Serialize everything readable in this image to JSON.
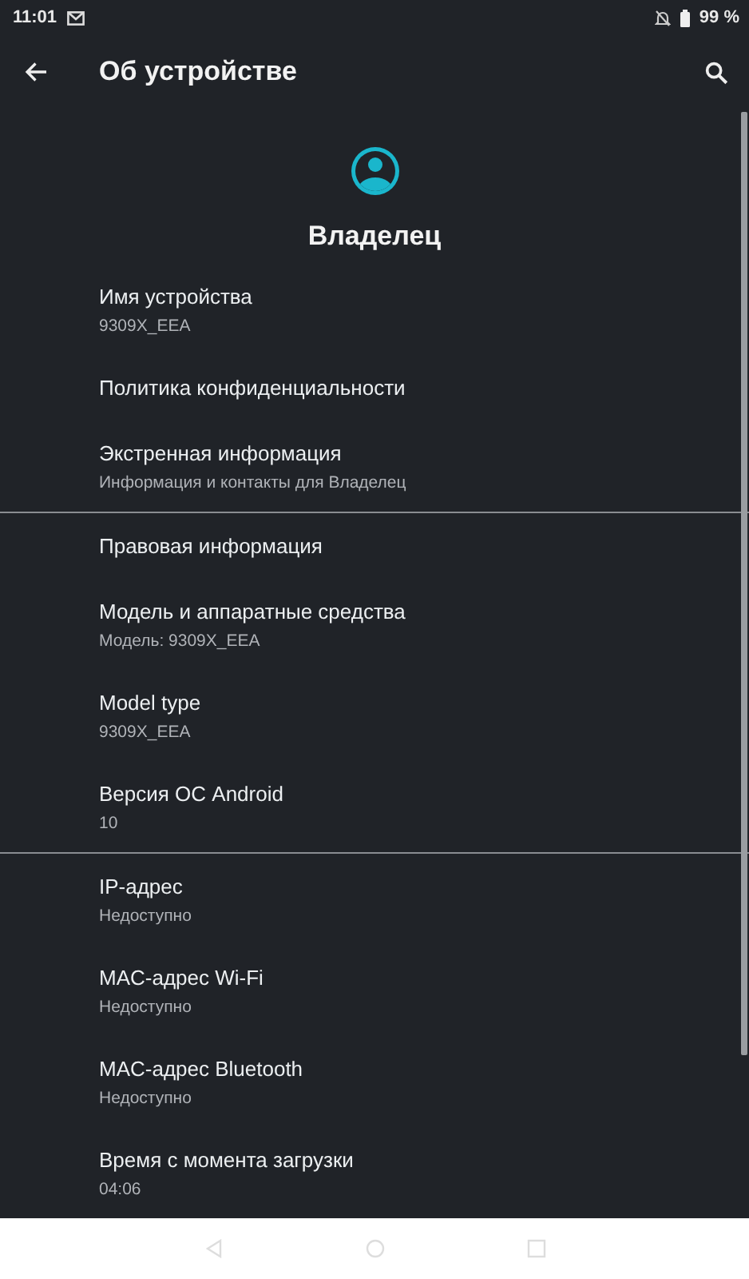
{
  "status_bar": {
    "time": "11:01",
    "battery": "99 %"
  },
  "toolbar": {
    "title": "Об устройстве"
  },
  "owner": {
    "name": "Владелец"
  },
  "sections": [
    {
      "items": [
        {
          "title": "Имя устройства",
          "subtitle": "9309X_EEA"
        },
        {
          "title": "Политика конфиденциальности"
        },
        {
          "title": "Экстренная информация",
          "subtitle": "Информация и контакты для Владелец"
        }
      ]
    },
    {
      "items": [
        {
          "title": "Правовая информация"
        },
        {
          "title": "Модель и аппаратные средства",
          "subtitle": "Модель: 9309X_EEA"
        },
        {
          "title": "Model type",
          "subtitle": "9309X_EEA"
        },
        {
          "title": "Версия ОС Android",
          "subtitle": "10"
        }
      ]
    },
    {
      "items": [
        {
          "title": "IP-адрес",
          "subtitle": "Недоступно"
        },
        {
          "title": "MAC-адрес Wi-Fi",
          "subtitle": "Недоступно"
        },
        {
          "title": "MAC-адрес Bluetooth",
          "subtitle": "Недоступно"
        },
        {
          "title": "Время с момента загрузки",
          "subtitle": "04:06"
        }
      ]
    }
  ]
}
